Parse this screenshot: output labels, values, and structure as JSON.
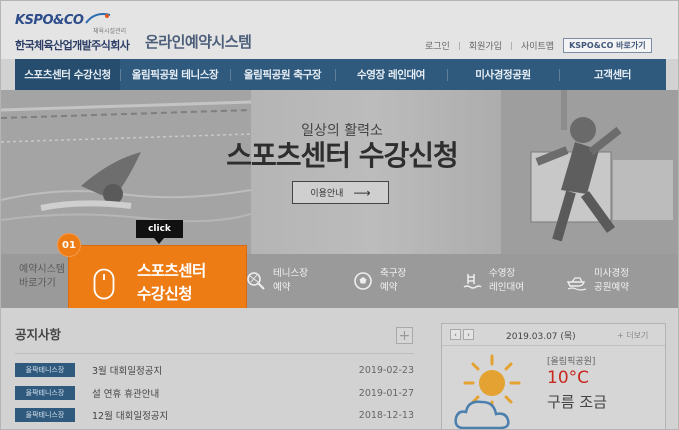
{
  "header": {
    "logo_mark": "KSPO&CO",
    "logo_sub": "체육시설관리",
    "company": "한국체육산업개발주식회사",
    "site_title": "온라인예약시스템",
    "util_links": [
      "로그인",
      "회원가입",
      "사이트맵"
    ],
    "util_button": "KSPO&CO 바로가기"
  },
  "nav": {
    "items": [
      "스포츠센터 수강신청",
      "올림픽공원 테니스장",
      "올림픽공원 축구장",
      "수영장 레인대여",
      "미사경정공원",
      "고객센터"
    ]
  },
  "banner": {
    "subtitle": "일상의 활력소",
    "title": "스포츠센터 수강신청",
    "button_label": "이용안내",
    "button_arrow": "⟶"
  },
  "quick": {
    "label_line1": "예약시스템",
    "label_line2": "바로가기",
    "items": [
      {
        "line1": "스포츠센터",
        "line2": "수강신청",
        "icon": "mouse-icon"
      },
      {
        "line1": "테니스장",
        "line2": "예약",
        "icon": "tennis-icon"
      },
      {
        "line1": "축구장",
        "line2": "예약",
        "icon": "soccer-icon"
      },
      {
        "line1": "수영장",
        "line2": "레인대여",
        "icon": "swimming-icon"
      },
      {
        "line1": "미사경정",
        "line2": "공원예약",
        "icon": "boat-icon"
      }
    ]
  },
  "tutorial": {
    "step": "01",
    "tooltip": "click",
    "accent": "#ee7c15"
  },
  "notice": {
    "title": "공지사항",
    "more": "+",
    "rows": [
      {
        "tag": "올팍테니스장",
        "text": "3월 대회일정공지",
        "date": "2019-02-23"
      },
      {
        "tag": "올팍테니스장",
        "text": "설 연휴 휴관안내",
        "date": "2019-01-27"
      },
      {
        "tag": "올팍테니스장",
        "text": "12월 대회일정공지",
        "date": "2018-12-13"
      }
    ]
  },
  "weather": {
    "prev": "‹",
    "next": "›",
    "date": "2019.03.07 (목)",
    "more": "+ 더보기",
    "place": "[올림픽공원]",
    "temp": "10°C",
    "desc": "구름 조금",
    "icon": "sun-cloud-icon"
  },
  "colors": {
    "nav_bg": "#2f5a7e",
    "accent_orange": "#ee7c15",
    "temp_red": "#c8281e"
  }
}
